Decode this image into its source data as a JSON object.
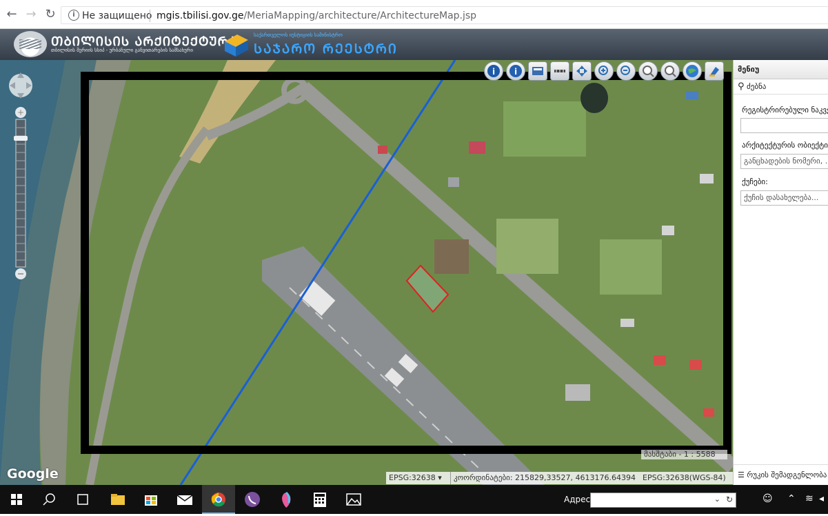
{
  "browser": {
    "security_label": "Не защищено",
    "url_domain": "mgis.tbilisi.gov.ge",
    "url_path": "/MeriaMapping/architecture/ArchitectureMap.jsp"
  },
  "header": {
    "brand_title": "ᲗᲑᲘᲚᲘᲡᲘᲡ ᲐᲠᲥᲘᲢᲔᲥᲢᲣᲠᲐ",
    "brand_subtitle": "თბილისის მერიის სსიპ - ურბანული განვითარების სამსახური",
    "agency_subtitle": "საქართველოს იუსტიციის სამინისტრო",
    "agency_title": "ᲡᲐᲯᲐᲠᲝ ᲠᲔᲔᲡᲢᲠᲘ"
  },
  "map": {
    "google_label": "Google",
    "scale_text": "მასშტაბი - 1 : 5588",
    "epsg_selected": "EPSG:32638",
    "coords_label": "კოორდინატები: 215829,33527, 4613176.64394",
    "projection_label": "EPSG:32638(WGS-84)"
  },
  "toolbar": {
    "icons": [
      "info-icon",
      "identify-icon",
      "layers-icon",
      "measure-icon",
      "pan-icon",
      "zoom-in-icon",
      "zoom-out-icon",
      "zoom-box-icon",
      "zoom-extent-icon",
      "globe-icon",
      "clear-icon"
    ]
  },
  "side": {
    "menu_title": "მენიუ",
    "search_label": "ძებნა",
    "registered_label": "რეგისტრირებული ნაკვეთი",
    "registered_value": "",
    "architecture_label": "არქიტექტურის ობიექტი",
    "architecture_placeholder": "განცხადების ნომერი, ...",
    "streets_label": "ქუჩები:",
    "streets_placeholder": "ქუჩის დასახელება...",
    "footer_label": "რუკის შემადგენლობა"
  },
  "taskbar": {
    "address_label": "Адрес",
    "apps": [
      "windows-start",
      "search",
      "task-view",
      "file-explorer",
      "store",
      "mail",
      "chrome",
      "viber",
      "paint3d",
      "calculator",
      "photos"
    ]
  },
  "colors": {
    "header_top": "#5a6572",
    "accent_blue": "#3aa6ff",
    "parcel_outline": "#e02020",
    "boundary_line": "#1a5fd6"
  }
}
